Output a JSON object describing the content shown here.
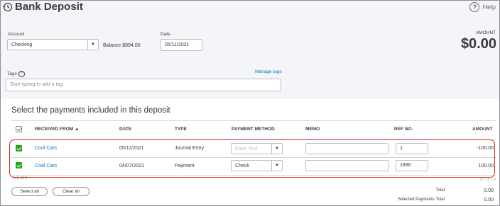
{
  "header": {
    "title": "Bank Deposit",
    "help_label": "Help",
    "help_icon": "help-circle-icon",
    "title_icon": "history-clock-icon"
  },
  "form": {
    "account_label": "Account",
    "account_value": "Checking",
    "balance_text": "Balance $894.00",
    "date_label": "Date",
    "date_value": "05/11/2021",
    "amount_label": "AMOUNT",
    "amount_value": "$0.00",
    "tags_label": "Tags",
    "manage_tags": "Manage tags",
    "tags_placeholder": "Start typing to add a tag"
  },
  "payments": {
    "section_title": "Select the payments included in this deposit",
    "columns": [
      "RECEIVED FROM ▲",
      "DATE",
      "TYPE",
      "PAYMENT METHOD",
      "MEMO",
      "REF NO.",
      "AMOUNT"
    ],
    "rows": [
      {
        "checked": true,
        "received_from": "Cool Cars",
        "date": "05/11/2021",
        "type": "Journal Entry",
        "payment_method": "",
        "payment_method_placeholder": "Enter Text",
        "memo": "",
        "ref_no": "1",
        "amount": "-100.00"
      },
      {
        "checked": true,
        "received_from": "Cool Cars",
        "date": "04/07/2021",
        "type": "Payment",
        "payment_method": "Check",
        "payment_method_placeholder": "",
        "memo": "",
        "ref_no": "1886",
        "amount": "100.00"
      }
    ],
    "pager_range": "1-2 of 2",
    "pager_nav": "‹‹  ‹  1  ›  ››"
  },
  "actions": {
    "select_all": "Select all",
    "clear_all": "Clear all"
  },
  "totals": {
    "total_label": "Total",
    "total_value": "0.00",
    "selected_label": "Selected Payments Total",
    "selected_value": "0.00"
  },
  "colors": {
    "link": "#0077c5",
    "check_green": "#2ca01c",
    "highlight_red": "#d52b1e",
    "top_bg": "#f4f5f8"
  }
}
